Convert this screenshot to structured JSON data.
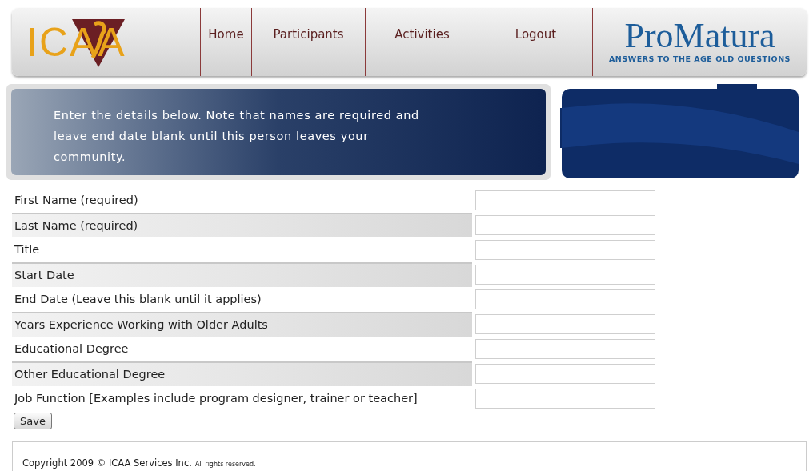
{
  "logo": {
    "text": "ICAA"
  },
  "nav": [
    {
      "label": "Home"
    },
    {
      "label": "Participants"
    },
    {
      "label": "Activities"
    },
    {
      "label": "Logout"
    }
  ],
  "partner_logo": {
    "name": "ProMatura",
    "tagline": "ANSWERS TO THE AGE OLD QUESTIONS"
  },
  "intro": "Enter the details below. Note that names are required and leave end date blank until this person leaves your community.",
  "fields": [
    {
      "label": "First Name (required)"
    },
    {
      "label": "Last Name (required)"
    },
    {
      "label": "Title"
    },
    {
      "label": "Start Date"
    },
    {
      "label": "End Date (Leave this blank until it applies)"
    },
    {
      "label": "Years Experience Working with Older Adults"
    },
    {
      "label": "Educational Degree"
    },
    {
      "label": "Other Educational Degree"
    },
    {
      "label": "Job Function [Examples include program designer, trainer or teacher]"
    }
  ],
  "save_button": "Save",
  "footer": {
    "copyright": "Copyright 2009 © ICAA Services Inc.",
    "rights": "All rights reserved."
  }
}
